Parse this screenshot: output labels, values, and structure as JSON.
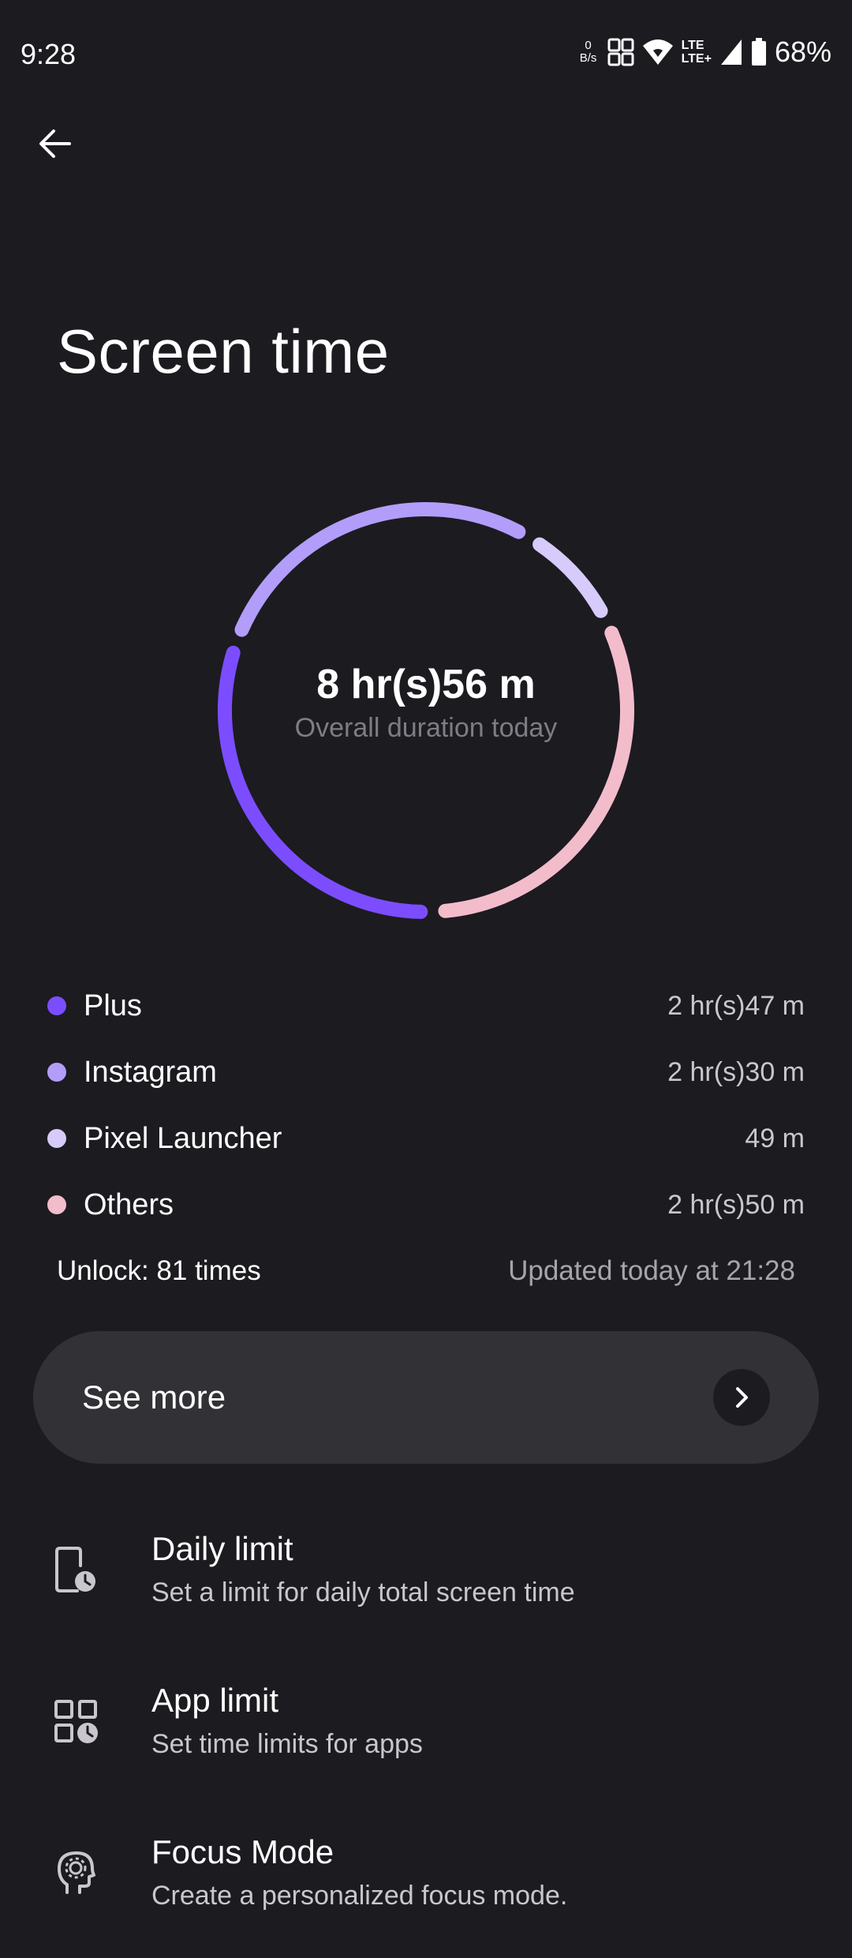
{
  "status_bar": {
    "time": "9:28",
    "net_speed_value": "0",
    "net_speed_unit": "B/s",
    "lte_top": "LTE",
    "lte_bottom": "LTE+",
    "battery_percent": "68%"
  },
  "header": {
    "title": "Screen time"
  },
  "summary": {
    "total_duration": "8 hr(s)56 m",
    "caption": "Overall duration today"
  },
  "chart_data": {
    "type": "pie",
    "categories": [
      "Plus",
      "Instagram",
      "Pixel Launcher",
      "Others"
    ],
    "values": [
      167,
      150,
      49,
      170
    ],
    "value_labels": [
      "2 hr(s)47 m",
      "2 hr(s)30 m",
      "49 m",
      "2 hr(s)50 m"
    ],
    "colors": [
      "#7c4dff",
      "#b39dfa",
      "#d6cbfb",
      "#f3bccb"
    ]
  },
  "legend": [
    {
      "name": "Plus",
      "value": "2 hr(s)47 m",
      "color": "#7c4dff"
    },
    {
      "name": "Instagram",
      "value": "2 hr(s)30 m",
      "color": "#b39dfa"
    },
    {
      "name": "Pixel Launcher",
      "value": "49 m",
      "color": "#d6cbfb"
    },
    {
      "name": "Others",
      "value": "2 hr(s)50 m",
      "color": "#f3bccb"
    }
  ],
  "meta": {
    "unlock": "Unlock: 81 times",
    "updated": "Updated today at 21:28"
  },
  "see_more": {
    "label": "See more"
  },
  "settings": [
    {
      "title": "Daily limit",
      "subtitle": "Set a limit for daily total screen time",
      "icon": "phone-clock-icon"
    },
    {
      "title": "App limit",
      "subtitle": "Set time limits for apps",
      "icon": "apps-clock-icon"
    },
    {
      "title": "Focus Mode",
      "subtitle": "Create a personalized focus mode.",
      "icon": "focus-head-icon"
    }
  ]
}
